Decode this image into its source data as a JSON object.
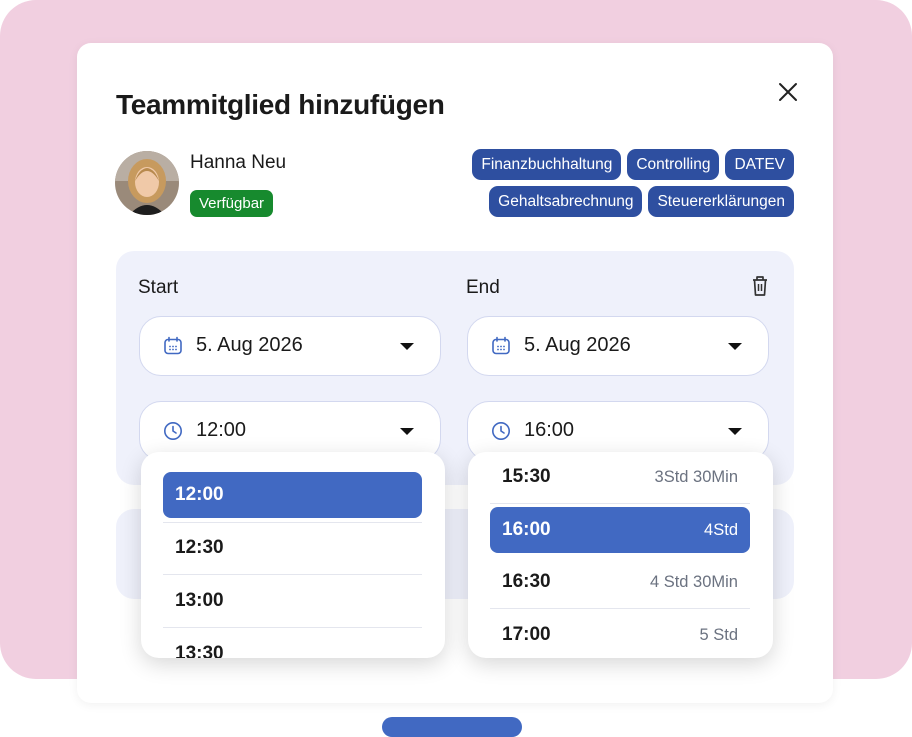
{
  "dialog": {
    "title": "Teammitglied hinzufügen"
  },
  "member": {
    "name": "Hanna Neu",
    "status": "Verfügbar",
    "status_color": "#178a2e",
    "tags": [
      "Finanzbuchhaltung",
      "Controlling",
      "DATEV",
      "Gehaltsabrechnung",
      "Steuererklärungen"
    ],
    "tag_color": "#2e4fa0"
  },
  "schedule": {
    "start_label": "Start",
    "end_label": "End",
    "start_date": "5. Aug 2026",
    "end_date": "5. Aug 2026",
    "start_time": "12:00",
    "end_time": "16:00"
  },
  "start_dropdown": {
    "options": [
      {
        "time": "12:00",
        "selected": true
      },
      {
        "time": "12:30",
        "selected": false
      },
      {
        "time": "13:00",
        "selected": false
      },
      {
        "time": "13:30",
        "selected": false
      }
    ]
  },
  "end_dropdown": {
    "options": [
      {
        "time": "15:30",
        "duration": "3Std 30Min",
        "selected": false
      },
      {
        "time": "16:00",
        "duration": "4Std",
        "selected": true
      },
      {
        "time": "16:30",
        "duration": "4 Std 30Min",
        "selected": false
      },
      {
        "time": "17:00",
        "duration": "5 Std",
        "selected": false
      }
    ]
  },
  "icons": {
    "close": "close-icon",
    "calendar": "calendar-icon",
    "clock": "clock-icon",
    "trash": "trash-icon",
    "caret": "caret-down-icon"
  },
  "accent_color": "#4169c2"
}
